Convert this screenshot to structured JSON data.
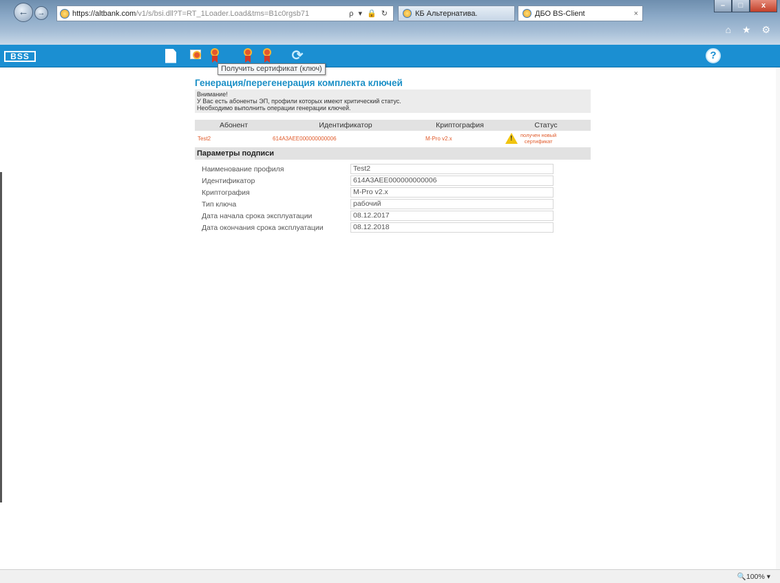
{
  "browser": {
    "url_host": "https://altbank.com",
    "url_path": "/v1/s/bsi.dll?T=RT_1Loader.Load&tms=B1c0rgsb71",
    "addr_tools": "ρ ▾ 🔒 ↻",
    "tabs": [
      {
        "label": "КБ Альтернатива."
      },
      {
        "label": "ДБО BS-Client",
        "close": "×"
      }
    ],
    "window_controls": {
      "minimize": "–",
      "maximize": "□",
      "close": "x"
    },
    "nav": {
      "back": "←",
      "forward": "→"
    },
    "right_icons": "⌂ ★ ⚙"
  },
  "app": {
    "logo": "BSS",
    "tooltip": "Получить сертификат (ключ)",
    "help": "?"
  },
  "page": {
    "title": "Генерация/перегенерация комплекта ключей",
    "alert_lines": [
      "Внимание!",
      "У Вас есть абоненты ЭП, профили которых имеют критический статус.",
      "Необходимо выполнить операции генерации ключей."
    ],
    "table": {
      "headers": [
        "Абонент",
        "Идентификатор",
        "Криптография",
        "Статус"
      ],
      "rows": [
        {
          "subscriber": "Test2",
          "id": "614A3AEE000000000006",
          "crypto": "M-Pro v2.x",
          "status_line1": "получен новый",
          "status_line2": "сертификат"
        }
      ]
    },
    "section_title": "Параметры подписи",
    "params": [
      {
        "label": "Наименование профиля",
        "value": "Test2"
      },
      {
        "label": "Идентификатор",
        "value": "614A3AEE000000000006"
      },
      {
        "label": "Криптография",
        "value": "M-Pro v2.x"
      },
      {
        "label": "Тип ключа",
        "value": "рабочий"
      },
      {
        "label": "Дата начала срока эксплуатации",
        "value": "08.12.2017"
      },
      {
        "label": "Дата окончания срока эксплуатации",
        "value": "08.12.2018"
      }
    ]
  },
  "status_bar": {
    "zoom": "🔍100%  ▾"
  },
  "colors": {
    "app_bar": "#1b8fd2",
    "title": "#1a8fc6",
    "status_orange": "#e05a2a"
  }
}
